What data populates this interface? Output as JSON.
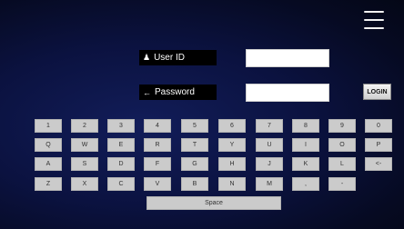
{
  "login": {
    "user_label": "User ID",
    "password_label": "Password",
    "user_icon": "person-icon",
    "password_icon": "arrow-left-icon",
    "user_value": "",
    "password_value": "",
    "login_button": "LOGIN"
  },
  "menu": {
    "icon": "hamburger-menu-icon"
  },
  "keyboard": {
    "rows": [
      [
        "1",
        "2",
        "3",
        "4",
        "5",
        "6",
        "7",
        "8",
        "9",
        "0"
      ],
      [
        "Q",
        "W",
        "E",
        "R",
        "T",
        "Y",
        "U",
        "I",
        "O",
        "P"
      ],
      [
        "A",
        "S",
        "D",
        "F",
        "G",
        "H",
        "J",
        "K",
        "L",
        "<-"
      ],
      [
        "Z",
        "X",
        "C",
        "V",
        "B",
        "N",
        "M",
        ",",
        "-"
      ]
    ],
    "space": "Space"
  }
}
